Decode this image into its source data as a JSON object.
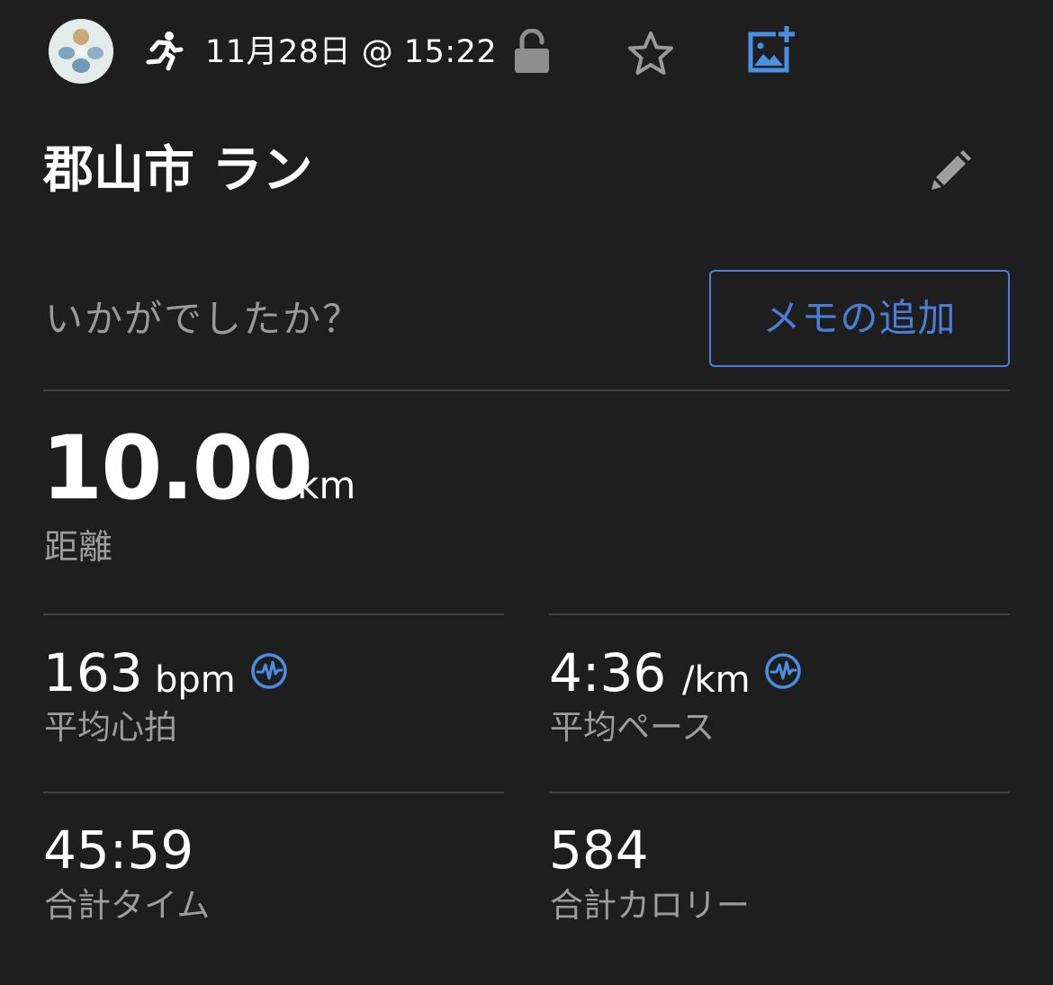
{
  "header": {
    "datetime": "11月28日 @ 15:22",
    "icons": [
      "avatar",
      "running-icon",
      "unlock-icon",
      "star-icon",
      "add-photo-icon"
    ]
  },
  "activity": {
    "title": "郡山市 ラン",
    "edit_icon": "pencil-icon"
  },
  "notes": {
    "prompt": "いかがでしたか？",
    "add_memo_label": "メモの追加"
  },
  "distance": {
    "value": "10.00",
    "unit": "km",
    "label": "距離"
  },
  "stats": [
    {
      "value": "163",
      "unit": "bpm",
      "label": "平均心拍",
      "badge": "heart-rate-icon"
    },
    {
      "value": "4:36",
      "unit": "/km",
      "label": "平均ペース",
      "badge": "heart-rate-icon"
    },
    {
      "value": "45:59",
      "unit": "",
      "label": "合計タイム"
    },
    {
      "value": "584",
      "unit": "",
      "label": "合計カロリー"
    }
  ],
  "colors": {
    "background": "#1e1e1e",
    "accent": "#4a7fd8",
    "muted_text": "#9a9a9a",
    "divider": "#424242"
  }
}
